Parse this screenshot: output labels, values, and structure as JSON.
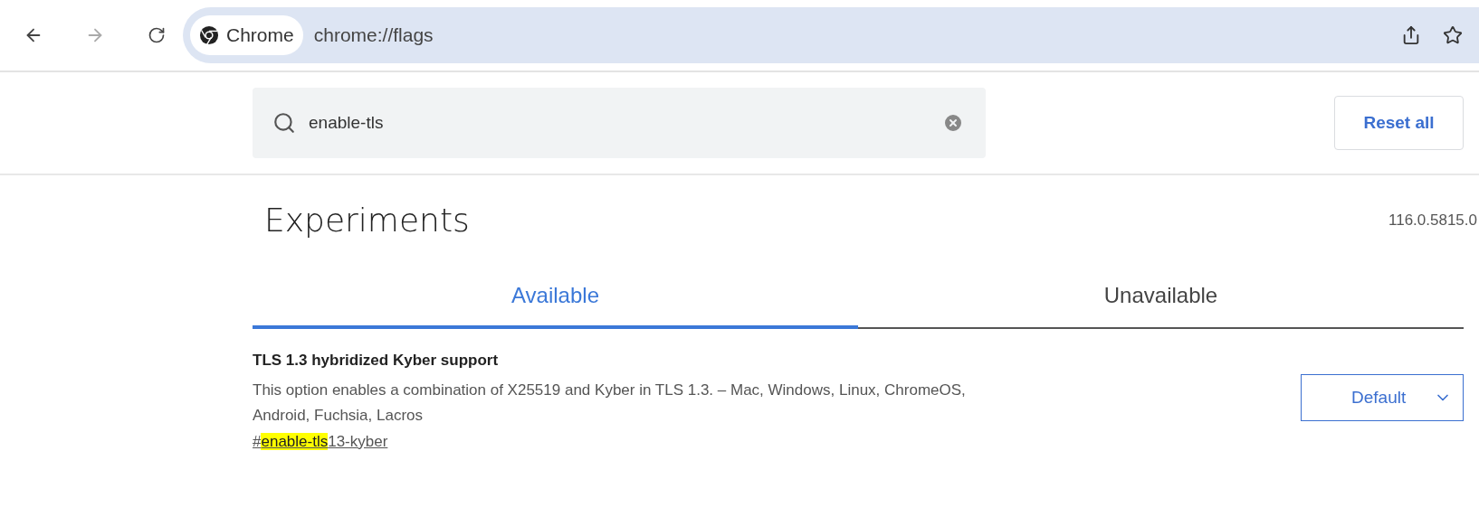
{
  "toolbar": {
    "back_enabled": true,
    "forward_enabled": false,
    "site_chip": "Chrome",
    "url": "chrome://flags"
  },
  "search": {
    "value": "enable-tls"
  },
  "reset_button": "Reset all",
  "title": "Experiments",
  "version": "116.0.5815.0",
  "tabs": [
    {
      "label": "Available",
      "selected": true
    },
    {
      "label": "Unavailable",
      "selected": false
    }
  ],
  "flags": [
    {
      "name": "TLS 1.3 hybridized Kyber support",
      "description": "This option enables a combination of X25519 and Kyber in TLS 1.3. – Mac, Windows, Linux, ChromeOS, Android, Fuchsia, Lacros",
      "link_parts": [
        {
          "text": "#",
          "highlighted": false
        },
        {
          "text": "enable-tls",
          "highlighted": true
        },
        {
          "text": "13-kyber",
          "highlighted": false
        }
      ],
      "select_value": "Default"
    }
  ]
}
